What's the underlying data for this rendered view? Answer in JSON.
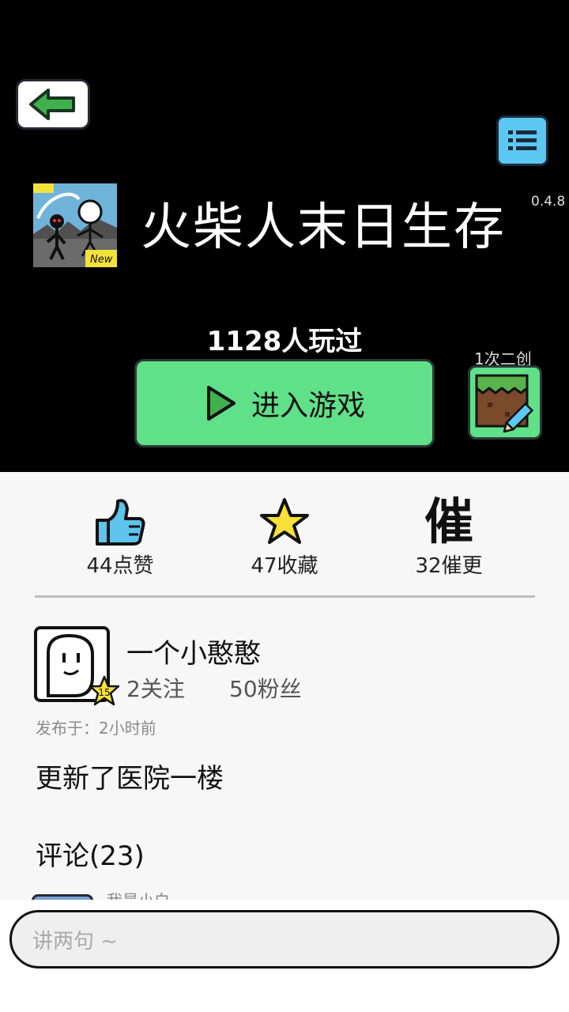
{
  "header": {
    "title": "火柴人末日生存",
    "version": "0.4.8",
    "players": "1128人玩过",
    "enter_label": "进入游戏",
    "remix_count": "1次二创"
  },
  "stats": {
    "likes": "44点赞",
    "favorites": "47收藏",
    "urges": "32催更",
    "urge_glyph": "催"
  },
  "author": {
    "name": "一个小憨憨",
    "level": "15",
    "follows": "2关注",
    "fans": "50粉丝"
  },
  "post": {
    "published": "发布于：2小时前",
    "content": "更新了医院一楼"
  },
  "comments": {
    "title": "评论(23)",
    "first_author": "我是小白"
  },
  "input": {
    "placeholder": "讲两句 ~"
  },
  "icons": {
    "back": "arrow-left-icon",
    "menu": "list-icon",
    "play": "play-icon",
    "remix": "edit-block-icon",
    "like": "thumbs-up-icon",
    "favorite": "star-icon",
    "urge": "urge-icon"
  },
  "colors": {
    "primary_green": "#60e089",
    "menu_blue": "#5bc8f2",
    "like_blue": "#5ec4ec",
    "star_yellow": "#f8e038"
  }
}
